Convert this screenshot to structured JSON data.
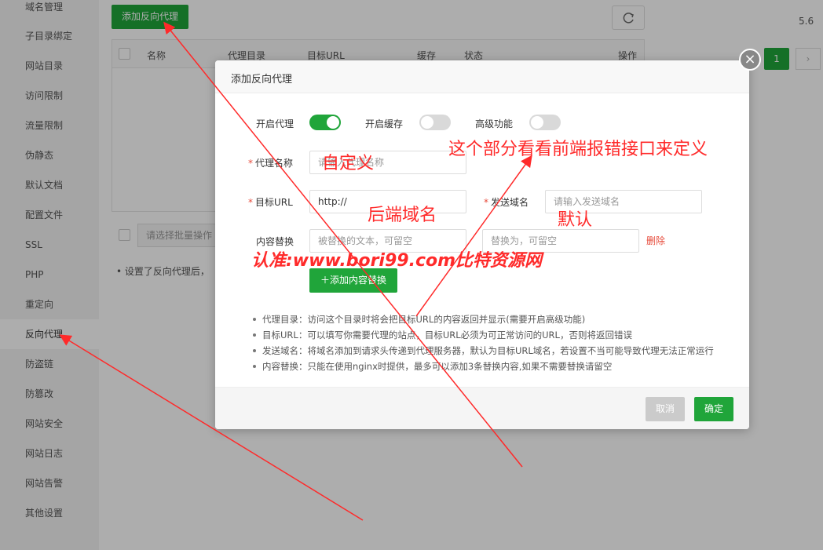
{
  "sidebar": {
    "items": [
      {
        "label": "域名管理"
      },
      {
        "label": "子目录绑定"
      },
      {
        "label": "网站目录"
      },
      {
        "label": "访问限制"
      },
      {
        "label": "流量限制"
      },
      {
        "label": "伪静态"
      },
      {
        "label": "默认文档"
      },
      {
        "label": "配置文件"
      },
      {
        "label": "SSL"
      },
      {
        "label": "PHP"
      },
      {
        "label": "重定向"
      },
      {
        "label": "反向代理"
      },
      {
        "label": "防盗链"
      },
      {
        "label": "防篡改"
      },
      {
        "label": "网站安全"
      },
      {
        "label": "网站日志"
      },
      {
        "label": "网站告警"
      },
      {
        "label": "其他设置"
      }
    ],
    "active_index": 11
  },
  "toolbar": {
    "add_proxy_label": "添加反向代理"
  },
  "table": {
    "columns": [
      "名称",
      "代理目录",
      "目标URL",
      "缓存",
      "状态",
      "操作"
    ]
  },
  "batch": {
    "placeholder": "请选择批量操作"
  },
  "bg_note": "设置了反向代理后，",
  "right_panel": {
    "version": "5.6",
    "page": "1"
  },
  "modal": {
    "title": "添加反向代理",
    "toggles": {
      "proxy_label": "开启代理",
      "proxy_on": true,
      "cache_label": "开启缓存",
      "cache_on": false,
      "advanced_label": "高级功能",
      "advanced_on": false
    },
    "fields": {
      "name_label": "代理名称",
      "name_placeholder": "请输入代理名称",
      "target_label": "目标URL",
      "target_value": "http://",
      "send_domain_label": "发送域名",
      "send_domain_placeholder": "请输入发送域名",
      "replace_label": "内容替换",
      "replace_from_placeholder": "被替换的文本，可留空",
      "replace_to_placeholder": "替换为，可留空",
      "delete_label": "删除",
      "add_replace_label": "添加内容替换"
    },
    "notes": [
      "代理目录：访问这个目录时将会把目标URL的内容返回并显示(需要开启高级功能)",
      "目标URL：可以填写你需要代理的站点，目标URL必须为可正常访问的URL，否则将返回错误",
      "发送域名：将域名添加到请求头传递到代理服务器，默认为目标URL域名，若设置不当可能导致代理无法正常运行",
      "内容替换：只能在使用nginx时提供，最多可以添加3条替换内容,如果不需要替换请留空"
    ],
    "cancel_label": "取消",
    "ok_label": "确定"
  },
  "annotations": {
    "custom": "自定义",
    "backend_domain": "后端域名",
    "default": "默认",
    "note_top": "这个部分看看前端报错接口来定义",
    "watermark": "认准:www.bori99.com比特资源网",
    "color": "#ff2a2a"
  }
}
